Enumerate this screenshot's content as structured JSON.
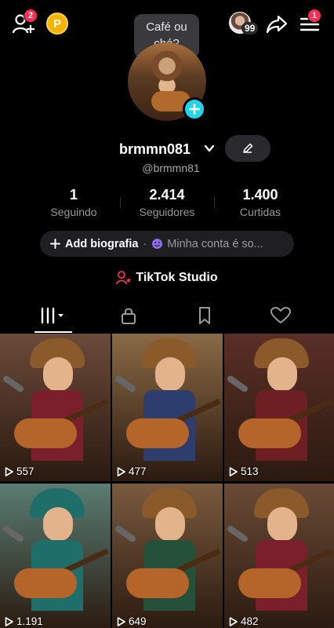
{
  "topbar": {
    "add_friends_badge": "2",
    "coin_letter": "P",
    "viewers_count": "99",
    "menu_badge": "1"
  },
  "tooltip": {
    "text": "Café ou chá?"
  },
  "profile": {
    "username": "brmmn081",
    "handle": "@brmmn81"
  },
  "stats": [
    {
      "value": "1",
      "label": "Seguindo"
    },
    {
      "value": "2.414",
      "label": "Seguidores"
    },
    {
      "value": "1.400",
      "label": "Curtidas"
    }
  ],
  "bio": {
    "add_label": "Add biografia",
    "separator": "·",
    "account_text": "Minha conta é so..."
  },
  "studio": {
    "label": "TikTok Studio"
  },
  "tabs": [
    {
      "name": "videos",
      "icon": "grid-icon",
      "active": true
    },
    {
      "name": "private",
      "icon": "lock-icon"
    },
    {
      "name": "saved",
      "icon": "bookmark-icon"
    },
    {
      "name": "liked",
      "icon": "heart-icon"
    }
  ],
  "videos": [
    {
      "views": "557",
      "shirt": "#7a1f2b",
      "bg": "#6b4a3a"
    },
    {
      "views": "477",
      "shirt": "#2c3d6e",
      "bg": "#8a6a45"
    },
    {
      "views": "513",
      "shirt": "#6e1f24",
      "bg": "#5a2f27"
    },
    {
      "views": "1.191",
      "shirt": "#1f6e6a",
      "bg": "#5a7d73"
    },
    {
      "views": "649",
      "shirt": "#25503a",
      "bg": "#7a5a3e"
    },
    {
      "views": "482",
      "shirt": "#7a1f2b",
      "bg": "#6a4a36"
    }
  ],
  "colors": {
    "accent_pink": "#fe2c55",
    "accent_cyan": "#20d5ec",
    "coin": "#f5b400"
  }
}
